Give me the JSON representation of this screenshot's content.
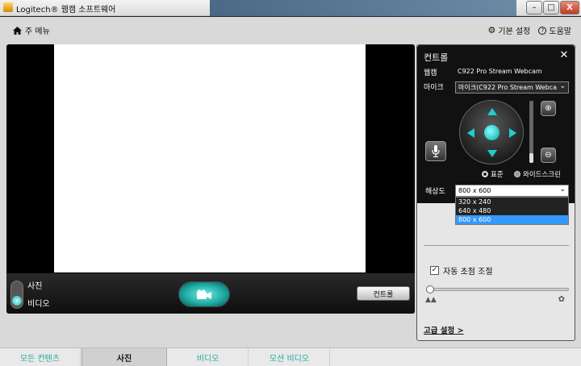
{
  "window": {
    "title": "Logitech® 웹캠 소프트웨어",
    "minimize": "–",
    "maximize": "□",
    "close": "X"
  },
  "topbar": {
    "home_label": "주 메뉴",
    "settings_label": "기본 설정",
    "help_label": "도움말"
  },
  "capture": {
    "mode_photo": "사진",
    "mode_video": "비디오",
    "selected_mode": "비디오",
    "control_button": "컨트롤"
  },
  "panel": {
    "title": "컨트롤",
    "webcam_label": "웹캠",
    "webcam_value": "C922 Pro Stream Webcam",
    "mic_label": "마이크",
    "mic_value": "마이크(C922 Pro Stream Webca",
    "zoom_level": 0.15,
    "aspect_standard": "표준",
    "aspect_wide": "와이드스크린",
    "aspect_selected": "표준",
    "resolution_label": "해상도",
    "resolution_value": "800 x 600",
    "resolution_options": [
      "320 x 240",
      "640 x 480",
      "800 x 600"
    ],
    "autofocus_label": "자동 초점 조절",
    "autofocus_checked": true,
    "focus_level": 0.0,
    "advanced_link": "고급 설정 >"
  },
  "tabs": [
    {
      "label": "모든 컨텐츠",
      "active": false
    },
    {
      "label": "사진",
      "active": true
    },
    {
      "label": "비디오",
      "active": false
    },
    {
      "label": "모션 비디오",
      "active": false
    }
  ],
  "colors": {
    "accent": "#22a8a0",
    "selection": "#3399ff"
  }
}
